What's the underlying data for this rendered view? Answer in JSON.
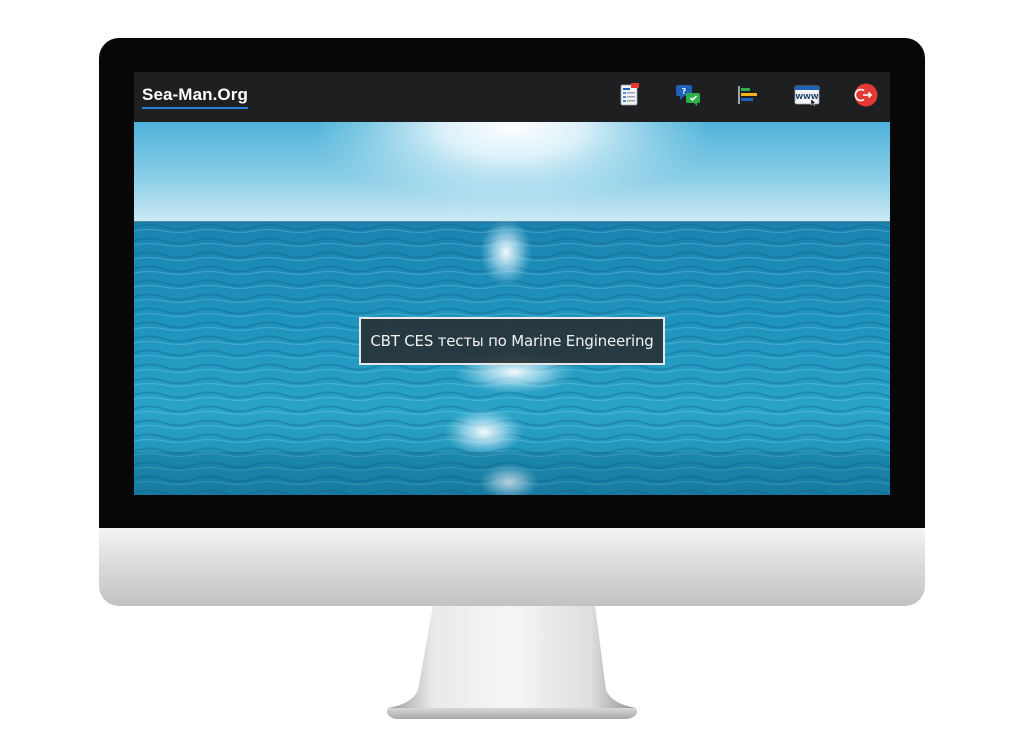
{
  "site": {
    "brand": "Sea-Man.Org"
  },
  "nav_icons": [
    {
      "name": "tests-icon",
      "label": "tests"
    },
    {
      "name": "question-answer-icon",
      "label": "questions"
    },
    {
      "name": "bar-list-icon",
      "label": "lists"
    },
    {
      "name": "www-icon",
      "label": "web"
    },
    {
      "name": "logout-icon",
      "label": "exit"
    }
  ],
  "hero": {
    "caption": "CBT CES тесты по Marine Engineering"
  },
  "colors": {
    "navbar": "#1d1f20",
    "brand_underline": "#2b7fd4",
    "logout_red": "#e53935",
    "sea_top": "#5fb8d6",
    "sea_deep": "#0f6f95"
  }
}
